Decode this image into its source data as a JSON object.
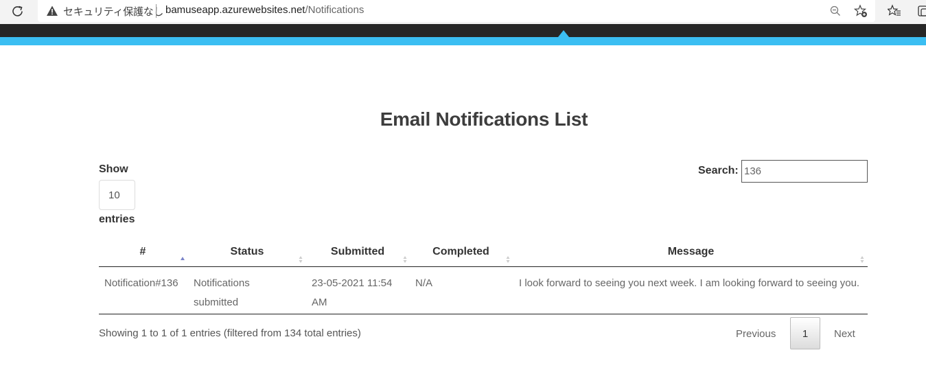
{
  "browser": {
    "security_label": "セキュリティ保護なし",
    "url_host": "bamuseapp.azurewebsites.net",
    "url_path": "/Notifications"
  },
  "page": {
    "title": "Email Notifications List"
  },
  "controls": {
    "show_label": "Show",
    "page_length": "10",
    "entries_label": "entries",
    "search_label": "Search:",
    "search_value": "136"
  },
  "table": {
    "columns": [
      "#",
      "Status",
      "Submitted",
      "Completed",
      "Message"
    ],
    "rows": [
      {
        "id": "Notification#136",
        "status": "Notifications submitted",
        "submitted": "23-05-2021 11:54 AM",
        "completed": "N/A",
        "message": "I look forward to seeing you next week. I am looking forward to seeing you."
      }
    ]
  },
  "footer": {
    "info": "Showing 1 to 1 of 1 entries (filtered from 134 total entries)",
    "prev_label": "Previous",
    "current_page": "1",
    "next_label": "Next"
  },
  "colors": {
    "nav_dark": "#262626",
    "nav_accent": "#3bbef2",
    "sort_active": "#7b84c9"
  }
}
